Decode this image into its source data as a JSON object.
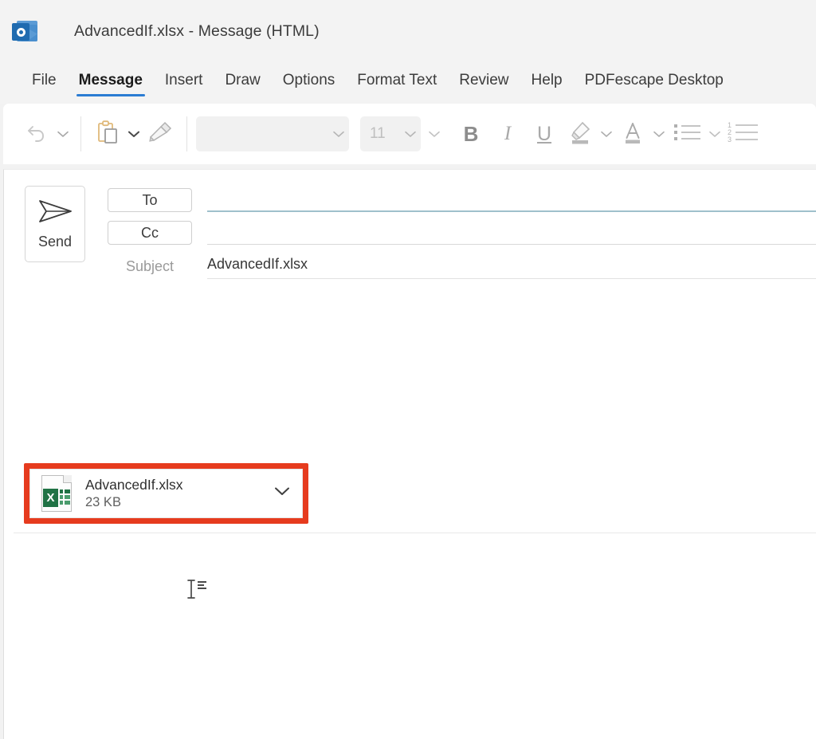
{
  "window": {
    "title": "AdvancedIf.xlsx  -  Message (HTML)",
    "app_icon": "outlook-icon"
  },
  "ribbon_tabs": [
    {
      "label": "File",
      "active": false
    },
    {
      "label": "Message",
      "active": true
    },
    {
      "label": "Insert",
      "active": false
    },
    {
      "label": "Draw",
      "active": false
    },
    {
      "label": "Options",
      "active": false
    },
    {
      "label": "Format Text",
      "active": false
    },
    {
      "label": "Review",
      "active": false
    },
    {
      "label": "Help",
      "active": false
    },
    {
      "label": "PDFescape Desktop",
      "active": false
    }
  ],
  "ribbon": {
    "undo_icon": "undo-icon",
    "undo_chevron_icon": "chevron-down-icon",
    "paste_icon": "paste-icon",
    "paste_chevron_icon": "chevron-down-icon",
    "format_painter_icon": "format-painter-icon",
    "font_name_value": "",
    "font_name_chevron_icon": "chevron-down-icon",
    "font_size_value": "11",
    "font_size_chevron_icon": "chevron-down-icon",
    "grow_font_chevron_icon": "chevron-down-icon",
    "bold_label": "B",
    "italic_label": "I",
    "underline_label": "U",
    "highlight_icon": "text-highlight-icon",
    "highlight_chevron_icon": "chevron-down-icon",
    "font_color_label": "A",
    "font_color_chevron_icon": "chevron-down-icon",
    "bullets_icon": "bulleted-list-icon",
    "bullets_chevron_icon": "chevron-down-icon",
    "numbering_icon": "numbered-list-icon"
  },
  "compose": {
    "send_label": "Send",
    "send_icon": "send-paper-plane-icon",
    "to_label": "To",
    "to_value": "",
    "cc_label": "Cc",
    "cc_value": "",
    "subject_label": "Subject",
    "subject_value": "AdvancedIf.xlsx",
    "body_value": "",
    "cursor_icon": "text-cursor-icon"
  },
  "attachment": {
    "file_icon": "excel-file-icon",
    "file_letter": "X",
    "file_name": "AdvancedIf.xlsx",
    "file_size": "23 KB",
    "dropdown_icon": "chevron-down-icon",
    "highlight_color": "#e63b1e"
  },
  "colors": {
    "accent_tab_underline": "#2b7cd3",
    "annotation_red": "#e63b1e",
    "excel_green": "#207245",
    "focused_field_underline": "#9fc0cc"
  }
}
